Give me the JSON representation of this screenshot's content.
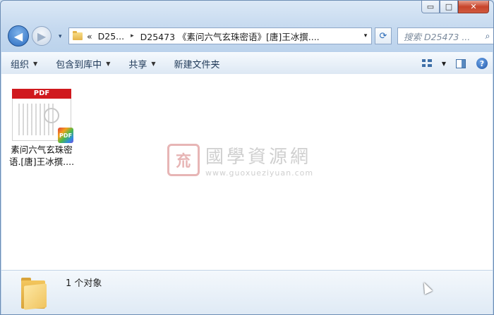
{
  "window": {
    "caption": {
      "minimize": "▭",
      "maximize": "□",
      "close": "✕"
    }
  },
  "navigation": {
    "back_glyph": "◀",
    "forward_glyph": "▶",
    "address": {
      "overflow": "«",
      "crumb_1": "D25...",
      "crumb_2": "D25473 《素问六气玄珠密语》[唐]王冰撰....",
      "separator": "▸",
      "dropdown": "▾"
    },
    "refresh_glyph": "⟳",
    "search_placeholder": "搜索 D25473 ...",
    "search_icon_glyph": "⌕"
  },
  "command_bar": {
    "organize": "组织",
    "include_in_library": "包含到库中",
    "share": "共享",
    "new_folder": "新建文件夹",
    "arrow": "▼",
    "help_glyph": "?"
  },
  "files": [
    {
      "type": "pdf",
      "badge": "PDF",
      "icon_label": "PDF",
      "name_line1": "素问六气玄珠密",
      "name_line2": "语.[唐]王冰撰...."
    }
  ],
  "watermark": {
    "seal_char": "㐬",
    "chinese": "國學資源網",
    "url": "www.guoxueziyuan.com"
  },
  "status": {
    "count_text": "1 个对象"
  },
  "colors": {
    "pdf_red": "#d0191e",
    "accent_blue": "#2b6cc0",
    "folder_yellow": "#f0c460"
  }
}
